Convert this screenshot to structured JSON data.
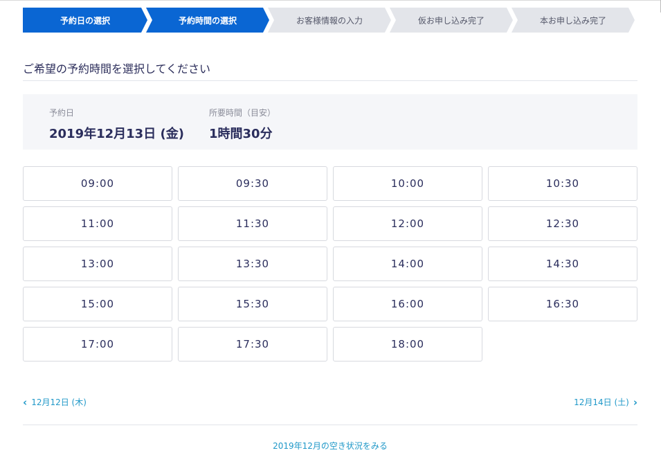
{
  "steps": [
    {
      "label": "予約日の選択",
      "state": "done"
    },
    {
      "label": "予約時間の選択",
      "state": "done"
    },
    {
      "label": "お客様情報の入力",
      "state": "todo"
    },
    {
      "label": "仮お申し込み完了",
      "state": "todo"
    },
    {
      "label": "本お申し込み完了",
      "state": "todo"
    }
  ],
  "heading": "ご希望の予約時間を選択してください",
  "summary": {
    "date_label": "予約日",
    "date_value": "2019年12月13日 (金)",
    "duration_label": "所要時間（目安）",
    "duration_value": "1時間30分"
  },
  "time_slots": [
    "09:00",
    "09:30",
    "10:00",
    "10:30",
    "11:00",
    "11:30",
    "12:00",
    "12:30",
    "13:00",
    "13:30",
    "14:00",
    "14:30",
    "15:00",
    "15:30",
    "16:00",
    "16:30",
    "17:00",
    "17:30",
    "18:00"
  ],
  "nav": {
    "prev_label": "12月12日 (木)",
    "next_label": "12月14日 (土)"
  },
  "month_link": "2019年12月の空き状況をみる",
  "colors": {
    "step_active": "#0a66d3",
    "step_inactive": "#e3e5ea",
    "link": "#1f98c8",
    "text_dark": "#2a2d5c"
  }
}
